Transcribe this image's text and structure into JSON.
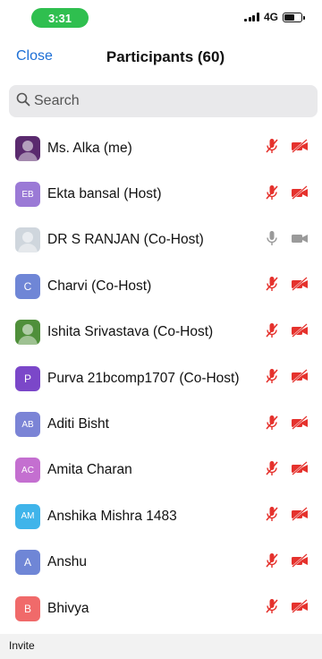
{
  "status_bar": {
    "time": "3:31",
    "network": "4G"
  },
  "header": {
    "close_label": "Close",
    "title": "Participants (60)"
  },
  "search": {
    "placeholder": "Search"
  },
  "participants": [
    {
      "name": "Ms. Alka (me)",
      "avatar_type": "photo",
      "avatar_color": "#5a2a6e",
      "muted": true,
      "video_off": true
    },
    {
      "name": "Ekta bansal (Host)",
      "avatar_initials": "EB",
      "avatar_color": "#9b7ad6",
      "muted": true,
      "video_off": true
    },
    {
      "name": "DR S RANJAN (Co-Host)",
      "avatar_type": "photo",
      "avatar_color": "#cfd6dd",
      "muted": true,
      "video_off": true,
      "icons_gray": true
    },
    {
      "name": "Charvi (Co-Host)",
      "avatar_initials": "C",
      "avatar_color": "#6f86d6",
      "muted": true,
      "video_off": true
    },
    {
      "name": "Ishita Srivastava (Co-Host)",
      "avatar_type": "photo",
      "avatar_color": "#4f8f3a",
      "muted": true,
      "video_off": true
    },
    {
      "name": "Purva 21bcomp1707 (Co-Host)",
      "avatar_initials": "P",
      "avatar_color": "#7b47c9",
      "muted": true,
      "video_off": true
    },
    {
      "name": "Aditi Bisht",
      "avatar_initials": "AB",
      "avatar_color": "#7b84d6",
      "muted": true,
      "video_off": true
    },
    {
      "name": "Amita Charan",
      "avatar_initials": "AC",
      "avatar_color": "#c46fd0",
      "muted": true,
      "video_off": true
    },
    {
      "name": "Anshika Mishra 1483",
      "avatar_initials": "AM",
      "avatar_color": "#3fb4ea",
      "muted": true,
      "video_off": true
    },
    {
      "name": "Anshu",
      "avatar_initials": "A",
      "avatar_color": "#6f86d6",
      "muted": true,
      "video_off": true
    },
    {
      "name": "Bhivya",
      "avatar_initials": "B",
      "avatar_color": "#f06a6a",
      "muted": true,
      "video_off": true
    }
  ],
  "footer": {
    "invite_label": "Invite"
  },
  "colors": {
    "accent": "#1d6fd6",
    "muted_icon": "#e5322d",
    "gray_icon": "#9a9a9a",
    "time_pill": "#2fbf4f"
  }
}
